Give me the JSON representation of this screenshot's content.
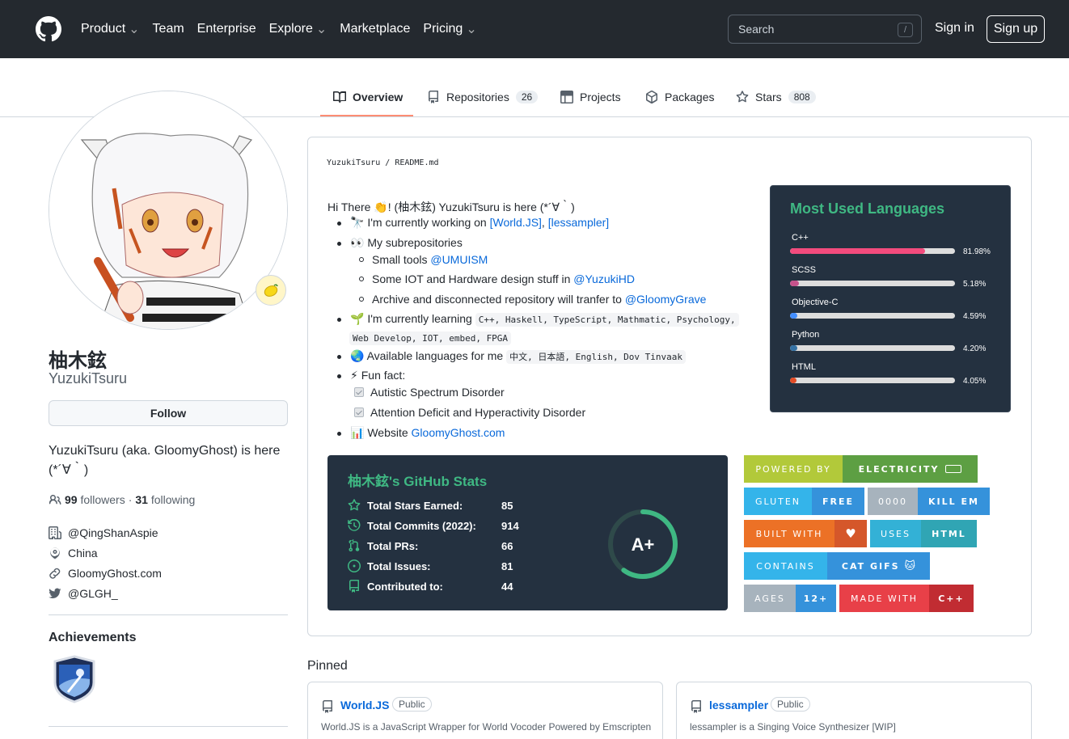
{
  "header": {
    "nav": [
      {
        "label": "Product",
        "dropdown": true
      },
      {
        "label": "Team",
        "dropdown": false
      },
      {
        "label": "Enterprise",
        "dropdown": false
      },
      {
        "label": "Explore",
        "dropdown": true
      },
      {
        "label": "Marketplace",
        "dropdown": false
      },
      {
        "label": "Pricing",
        "dropdown": true
      }
    ],
    "search_placeholder": "Search",
    "search_shortcut": "/",
    "signin": "Sign in",
    "signup": "Sign up"
  },
  "tabs": [
    {
      "label": "Overview",
      "icon": "book-icon",
      "count": null,
      "active": true
    },
    {
      "label": "Repositories",
      "icon": "repo-icon",
      "count": "26",
      "active": false
    },
    {
      "label": "Projects",
      "icon": "table-icon",
      "count": null,
      "active": false
    },
    {
      "label": "Packages",
      "icon": "package-icon",
      "count": null,
      "active": false
    },
    {
      "label": "Stars",
      "icon": "star-icon",
      "count": "808",
      "active": false
    }
  ],
  "profile": {
    "fullname": "柚木鉉",
    "username": "YuzukiTsuru",
    "follow_label": "Follow",
    "bio": "YuzukiTsuru (aka. GloomyGhost) is here (*´∀｀)",
    "followers_count": "99",
    "followers_label": "followers",
    "following_count": "31",
    "following_label": "following",
    "company": "@QingShanAspie",
    "location": "China",
    "website": "GloomyGhost.com",
    "twitter": "@GLGH_",
    "achievements_title": "Achievements",
    "status_emoji": "lemon"
  },
  "readme": {
    "path_user": "YuzukiTsuru",
    "path_sep": "/",
    "path_file": "README.md",
    "greeting": "Hi There 👏! (柚木鉉) YuzukiTsuru is here (*´∀｀)",
    "working_on_prefix": "I'm currently working on",
    "working_on_link1": "[World.JS]",
    "working_on_sep": ",",
    "working_on_link2": "[lessampler]",
    "subrepos_label": "My subrepositories",
    "subrepo1_text": "Small tools",
    "subrepo1_link": "@UMUISM",
    "subrepo2_text": "Some IOT and Hardware design stuff in",
    "subrepo2_link": "@YuzukiHD",
    "subrepo3_text": "Archive and disconnected repository will tranfer to",
    "subrepo3_link": "@GloomyGrave",
    "learning_prefix": "I'm currently learning",
    "learning_code1": "C++, Haskell, TypeScript, Mathmatic, Psychology,",
    "learning_code2": "Web Develop, IOT, embed, FPGA",
    "languages_prefix": "Available languages for me",
    "languages_code": "中文, 日本語, English, Dov Tinvaak",
    "funfact_label": "Fun fact:",
    "funfact1": "Autistic Spectrum Disorder",
    "funfact2": "Attention Deficit and Hyperactivity Disorder",
    "website_prefix": "Website",
    "website_link": "GloomyGhost.com"
  },
  "languages_card": {
    "title": "Most Used Languages",
    "items": [
      {
        "name": "C++",
        "percent": 81.98,
        "label": "81.98%",
        "color": "#f34b7d"
      },
      {
        "name": "SCSS",
        "percent": 5.18,
        "label": "5.18%",
        "color": "#c6538c"
      },
      {
        "name": "Objective-C",
        "percent": 4.59,
        "label": "4.59%",
        "color": "#438eff"
      },
      {
        "name": "Python",
        "percent": 4.2,
        "label": "4.20%",
        "color": "#3572A5"
      },
      {
        "name": "HTML",
        "percent": 4.05,
        "label": "4.05%",
        "color": "#e34c26"
      }
    ]
  },
  "stats_card": {
    "title": "柚木鉉's GitHub Stats",
    "rows": [
      {
        "label": "Total Stars Earned:",
        "value": "85",
        "icon": "star-icon"
      },
      {
        "label": "Total Commits (2022):",
        "value": "914",
        "icon": "history-icon"
      },
      {
        "label": "Total PRs:",
        "value": "66",
        "icon": "pull-request-icon"
      },
      {
        "label": "Total Issues:",
        "value": "81",
        "icon": "issue-icon"
      },
      {
        "label": "Contributed to:",
        "value": "44",
        "icon": "repo-icon"
      }
    ],
    "grade": "A+",
    "grade_progress": 0.6
  },
  "badges": [
    {
      "left": "POWERED BY",
      "right": "ELECTRICITY",
      "lc": "#b2c93a",
      "rc": "#5d9f43"
    },
    {
      "left": "GLUTEN",
      "right": "FREE",
      "lc": "#34b4ea",
      "rc": "#3592db"
    },
    {
      "left": "0000",
      "right": "KILL EM",
      "lc": "#a7b3bd",
      "rc": "#3592db"
    },
    {
      "left": "BUILT WITH",
      "right": "",
      "lc": "#ec7126",
      "rc": "#d5572a"
    },
    {
      "left": "USES",
      "right": "HTML",
      "lc": "#33b1d6",
      "rc": "#30a5b4"
    },
    {
      "left": "CONTAINS",
      "right": "CAT GIFS",
      "lc": "#34b4ea",
      "rc": "#3592db"
    },
    {
      "left": "AGES",
      "right": "12+",
      "lc": "#a7b3bd",
      "rc": "#3592db"
    },
    {
      "left": "MADE WITH",
      "right": "C++",
      "lc": "#e84048",
      "rc": "#c12c32"
    }
  ],
  "pinned": {
    "title": "Pinned",
    "items": [
      {
        "name": "World.JS",
        "visibility": "Public",
        "desc": "World.JS is a JavaScript Wrapper for World Vocoder Powered by Emscripten"
      },
      {
        "name": "lessampler",
        "visibility": "Public",
        "desc": "lessampler is a Singing Voice Synthesizer [WIP]"
      }
    ]
  }
}
